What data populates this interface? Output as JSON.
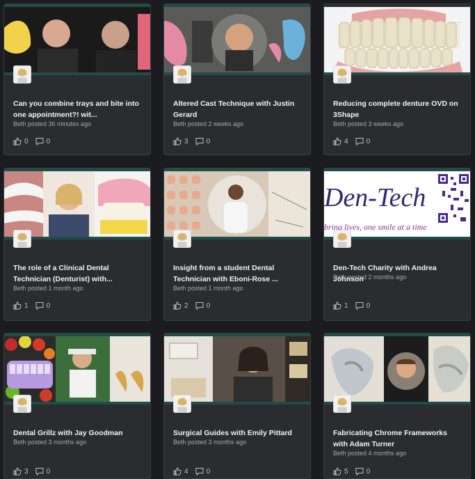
{
  "cards": [
    {
      "title": "Can you combine trays and bite into one appointment?! wit...",
      "meta": "Beth posted 36 minutes ago",
      "likes": "0",
      "comments": "0"
    },
    {
      "title": "Altered Cast Technique with Justin Gerard",
      "meta": "Beth posted 2 weeks ago",
      "likes": "3",
      "comments": "0"
    },
    {
      "title": "Reducing complete denture OVD on 3Shape",
      "meta": "Beth posted 3 weeks ago",
      "likes": "4",
      "comments": "0",
      "more": "..."
    },
    {
      "title": "The role of a Clinical Dental Technician (Denturist) with...",
      "meta": "Beth posted 1 month ago",
      "likes": "1",
      "comments": "0"
    },
    {
      "title": "Insight from a student Dental Technician with Eboni-Rose ...",
      "meta": "Beth posted 1 month ago",
      "likes": "2",
      "comments": "0"
    },
    {
      "title": "Den-Tech Charity with Andrea Johnson",
      "meta": "Beth posted 2 months ago",
      "likes": "1",
      "comments": "0",
      "thumb_text": "Den-Tech",
      "thumb_sub": "bring lives, one smile at a time"
    },
    {
      "title": "Dental Grillz with Jay Goodman",
      "meta": "Beth posted 3 months ago",
      "likes": "3",
      "comments": "0"
    },
    {
      "title": "Surgical Guides with Emily Pittard",
      "meta": "Beth posted 3 months ago",
      "likes": "4",
      "comments": "0"
    },
    {
      "title": "Fabricating Chrome Frameworks with Adam Turner",
      "meta": "Beth posted 4 months ago",
      "likes": "5",
      "comments": "0"
    }
  ],
  "icons": {
    "like": "thumbs-up-icon",
    "comment": "comment-icon"
  },
  "colors": {
    "background": "#1b1c1f",
    "card": "#2a2c30",
    "accent": "#1f4d4a"
  }
}
